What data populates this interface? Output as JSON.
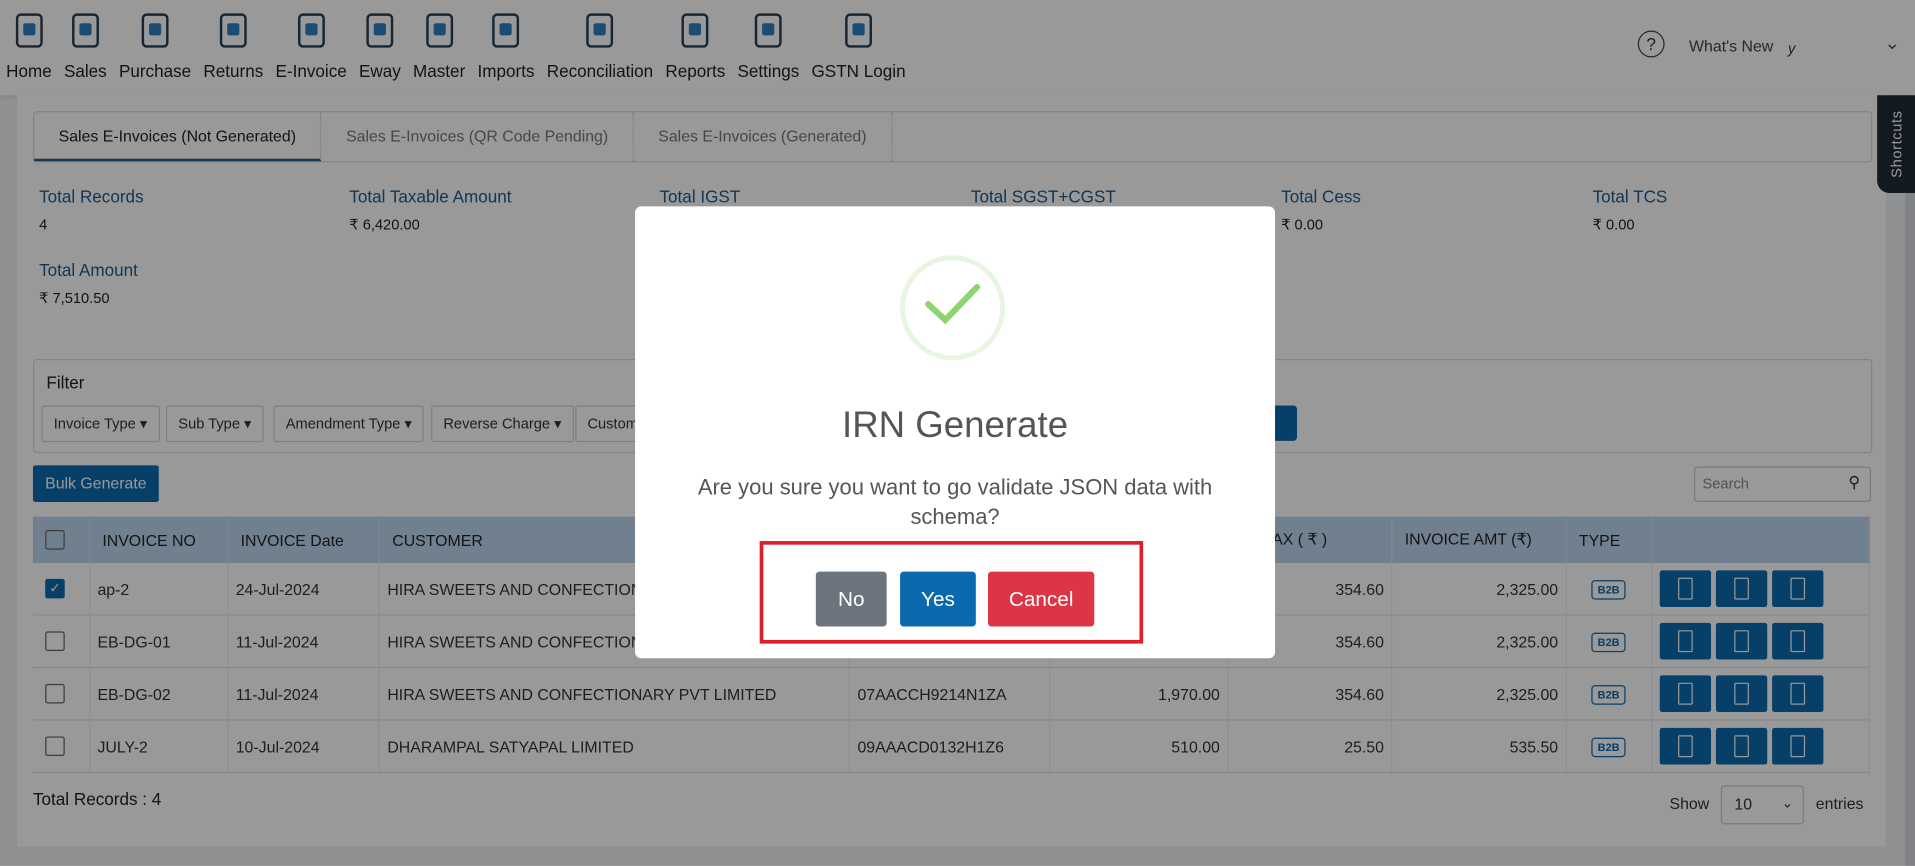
{
  "nav": [
    {
      "label": "Home",
      "icon": "home-icon"
    },
    {
      "label": "Sales",
      "icon": "sales-icon"
    },
    {
      "label": "Purchase",
      "icon": "purchase-icon"
    },
    {
      "label": "Returns",
      "icon": "returns-icon"
    },
    {
      "label": "E-Invoice",
      "icon": "e-invoice-icon"
    },
    {
      "label": "Eway",
      "icon": "truck-icon"
    },
    {
      "label": "Master",
      "icon": "master-icon"
    },
    {
      "label": "Imports",
      "icon": "import-icon"
    },
    {
      "label": "Reconciliation",
      "icon": "handshake-icon"
    },
    {
      "label": "Reports",
      "icon": "reports-icon"
    },
    {
      "label": "Settings",
      "icon": "settings-icon"
    },
    {
      "label": "GSTN Login",
      "icon": "gst-icon"
    }
  ],
  "header": {
    "help": "?",
    "whats_new": "What's New",
    "user_initial": "y",
    "chevron": "⌄",
    "shortcuts": "Shortcuts"
  },
  "tabs": [
    "Sales E-Invoices (Not Generated)",
    "Sales E-Invoices (QR Code Pending)",
    "Sales E-Invoices (Generated)"
  ],
  "stats": [
    {
      "label": "Total Records",
      "value": "4"
    },
    {
      "label": "Total Taxable Amount",
      "value": "₹ 6,420.00"
    },
    {
      "label": "Total IGST",
      "value": ""
    },
    {
      "label": "Total SGST+CGST",
      "value": ""
    },
    {
      "label": "Total Cess",
      "value": "₹ 0.00"
    },
    {
      "label": "Total TCS",
      "value": "₹ 0.00"
    },
    {
      "label": "Total Amount",
      "value": "₹ 7,510.50"
    }
  ],
  "filter": {
    "title": "Filter",
    "buttons": [
      "Invoice Type ▾",
      "Sub Type ▾",
      "Amendment Type ▾",
      "Reverse Charge ▾",
      "Customer"
    ]
  },
  "bulk_generate": "Bulk Generate",
  "search": {
    "placeholder": "Search"
  },
  "table": {
    "headers": [
      "INVOICE NO",
      "INVOICE Date",
      "CUSTOMER",
      "",
      "",
      "AL TAX ( ₹ )",
      "INVOICE AMT (₹)",
      "TYPE",
      ""
    ],
    "rows": [
      {
        "checked": true,
        "no": "ap-2",
        "date": "24-Jul-2024",
        "customer": "HIRA SWEETS AND CONFECTIONARY PVT LIMITED",
        "gstin": "",
        "taxable": "",
        "tax": "354.60",
        "amt": "2,325.00",
        "type": "B2B"
      },
      {
        "checked": false,
        "no": "EB-DG-01",
        "date": "11-Jul-2024",
        "customer": "HIRA SWEETS AND CONFECTIONARY PVT LIMITED",
        "gstin": "",
        "taxable": "",
        "tax": "354.60",
        "amt": "2,325.00",
        "type": "B2B"
      },
      {
        "checked": false,
        "no": "EB-DG-02",
        "date": "11-Jul-2024",
        "customer": "HIRA SWEETS AND CONFECTIONARY PVT LIMITED",
        "gstin": "07AACCH9214N1ZA",
        "taxable": "1,970.00",
        "tax": "354.60",
        "amt": "2,325.00",
        "type": "B2B"
      },
      {
        "checked": false,
        "no": "JULY-2",
        "date": "10-Jul-2024",
        "customer": "DHARAMPAL SATYAPAL LIMITED",
        "gstin": "09AAACD0132H1Z6",
        "taxable": "510.00",
        "tax": "25.50",
        "amt": "535.50",
        "type": "B2B"
      }
    ]
  },
  "footer": {
    "total_records": "Total Records : 4",
    "show": "Show",
    "page_size": "10",
    "entries": "entries"
  },
  "modal": {
    "title": "IRN Generate",
    "message": "Are you sure you want to go validate JSON data with schema?",
    "no": "No",
    "yes": "Yes",
    "cancel": "Cancel"
  },
  "colors": {
    "primary": "#0b6aad",
    "danger": "#dc3545",
    "secondary": "#6c757d",
    "highlight": "#e01e2a",
    "success": "#8dd36f"
  }
}
